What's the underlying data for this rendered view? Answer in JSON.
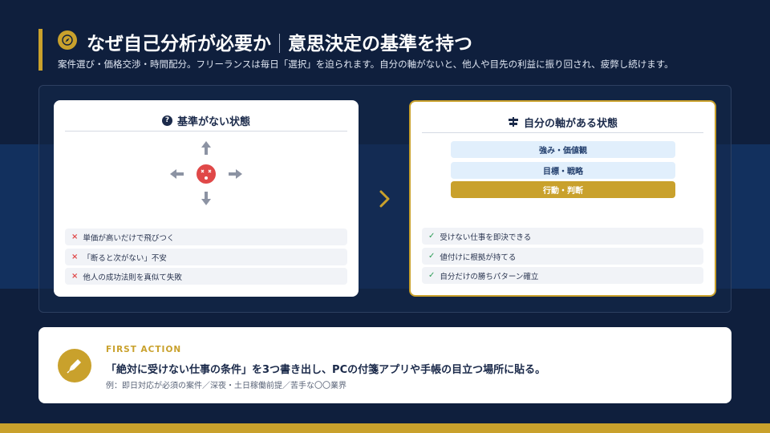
{
  "header": {
    "title_left": "なぜ自己分析が必要か",
    "title_right": "意思決定の基準を持つ",
    "subtitle": "案件選び・価格交渉・時間配分。フリーランスは毎日「選択」を迫られます。自分の軸がないと、他人や目先の利益に振り回され、疲弊し続けます。",
    "icon": "compass-icon"
  },
  "left_card": {
    "title": "基準がない状態",
    "badge": "?",
    "items": [
      "単価が高いだけで飛びつく",
      "「断ると次がない」不安",
      "他人の成功法則を真似て失敗"
    ]
  },
  "right_card": {
    "title": "自分の軸がある状態",
    "stack": [
      "強み・価値観",
      "目標・戦略",
      "行動・判断"
    ],
    "items": [
      "受けない仕事を即決できる",
      "値付けに根拠が持てる",
      "自分だけの勝ちパターン確立"
    ]
  },
  "action": {
    "label": "FIRST ACTION",
    "main": "「絶対に受けない仕事の条件」を3つ書き出し、PCの付箋アプリや手帳の目立つ場所に貼る。",
    "example": "例：即日対応が必須の案件／深夜・土日稼働前提／苦手な〇〇業界"
  },
  "colors": {
    "background": "#0f1f3d",
    "accent": "#c9a12c",
    "error": "#e04848",
    "success": "#2e9d57",
    "stack_light": "#e1effc"
  }
}
